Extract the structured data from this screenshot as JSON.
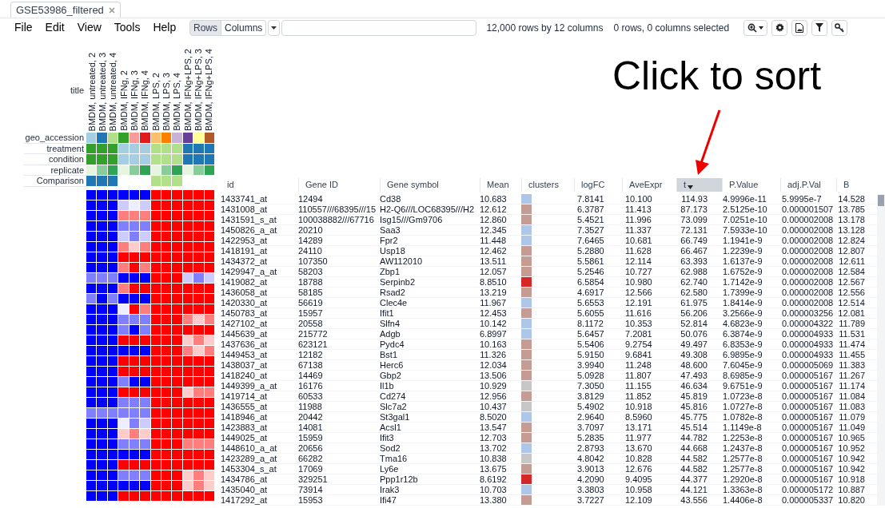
{
  "tab": {
    "title": "GSE53986_filtered"
  },
  "menu": [
    "File",
    "Edit",
    "View",
    "Tools",
    "Help"
  ],
  "toolbar": {
    "modes": [
      {
        "label": "Rows",
        "selected": true
      },
      {
        "label": "Columns",
        "selected": false
      }
    ],
    "summary": "12,000 rows by 12 columns",
    "selection": "0 rows, 0 columns selected"
  },
  "samples": {
    "label": "title",
    "titles": [
      "BMDM, untreated, 2",
      "BMDM, untreated, 3",
      "BMDM, untreated, 4",
      "BMDM, IFNg, 2",
      "BMDM, IFNg, 3",
      "BMDM, IFNg, 4",
      "BMDM, LPS, 2",
      "BMDM, LPS, 3",
      "BMDM, LPS, 4",
      "BMDM, IFNg+LPS, 2",
      "BMDM, IFNg+LPS, 3",
      "BMDM, IFNg+LPS, 4"
    ]
  },
  "annotations": [
    {
      "label": "geo_accession",
      "cells": [
        {
          "color": "#a6cee3"
        },
        {
          "color": "#1f78b4"
        },
        {
          "color": "#b2df8a"
        },
        {
          "color": "#33a02c"
        },
        {
          "color": "#fb9a99"
        },
        {
          "color": "#e31a1c"
        },
        {
          "color": "#fdbf6f"
        },
        {
          "color": "#ff7f00"
        },
        {
          "color": "#cab2d6"
        },
        {
          "color": "#6a3d9a"
        },
        {
          "color": "#ffff99"
        },
        {
          "color": "#b15928"
        }
      ]
    },
    {
      "label": "treatment",
      "cells": [
        {
          "color": "#33a02c"
        },
        {
          "color": "#33a02c"
        },
        {
          "color": "#33a02c"
        },
        {
          "color": "#a6cee3"
        },
        {
          "color": "#a6cee3"
        },
        {
          "color": "#a6cee3"
        },
        {
          "color": "#b2df8a"
        },
        {
          "color": "#b2df8a"
        },
        {
          "color": "#b2df8a"
        },
        {
          "color": "#1f78b4"
        },
        {
          "color": "#1f78b4"
        },
        {
          "color": "#1f78b4"
        }
      ]
    },
    {
      "label": "condition",
      "cells": [
        {
          "color": "#33a02c"
        },
        {
          "color": "#33a02c"
        },
        {
          "color": "#33a02c"
        },
        {
          "color": "#a6cee3"
        },
        {
          "color": "#a6cee3"
        },
        {
          "color": "#a6cee3"
        },
        {
          "color": "#b2df8a"
        },
        {
          "color": "#b2df8a"
        },
        {
          "color": "#b2df8a"
        },
        {
          "color": "#1f78b4"
        },
        {
          "color": "#1f78b4"
        },
        {
          "color": "#1f78b4"
        }
      ]
    },
    {
      "label": "replicate",
      "cells": [
        {
          "color": "#e5f5e0"
        },
        {
          "color": "#88cc99"
        },
        {
          "color": "#31a354"
        },
        {
          "color": "#e5f5e0"
        },
        {
          "color": "#88cc99"
        },
        {
          "color": "#31a354"
        },
        {
          "color": "#e5f5e0"
        },
        {
          "color": "#88cc99"
        },
        {
          "color": "#31a354"
        },
        {
          "color": "#e5f5e0"
        },
        {
          "color": "#88cc99"
        },
        {
          "color": "#31a354"
        }
      ]
    },
    {
      "label": "Comparison",
      "cells": [
        {
          "color": "#1f78b4"
        },
        {
          "color": "#1f78b4"
        },
        {
          "color": "#1f78b4"
        },
        {},
        {},
        {},
        {
          "color": "#b2df8a"
        },
        {
          "color": "#b2df8a"
        },
        {
          "color": "#b2df8a"
        },
        {},
        {},
        {}
      ]
    }
  ],
  "callout": {
    "text": "Click to sort"
  },
  "columns": [
    {
      "label": "id",
      "kind": "text",
      "sorted": false
    },
    {
      "label": "Gene ID",
      "kind": "text",
      "sorted": false
    },
    {
      "label": "Gene symbol",
      "kind": "text",
      "sorted": false
    },
    {
      "label": "Mean",
      "kind": "number",
      "sorted": false
    },
    {
      "label": "clusters",
      "kind": "color",
      "sorted": false
    },
    {
      "label": "logFC",
      "kind": "number",
      "sorted": false
    },
    {
      "label": "AveExpr",
      "kind": "number",
      "sorted": false
    },
    {
      "label": "t",
      "kind": "number",
      "sorted": true
    },
    {
      "label": "P.Value",
      "kind": "number",
      "sorted": false
    },
    {
      "label": "adj.P.Val",
      "kind": "number",
      "sorted": false
    },
    {
      "label": "B",
      "kind": "number",
      "sorted": false
    }
  ],
  "rows": [
    {
      "values": [
        "1433741_at",
        "12494",
        "Cd38",
        "10.683",
        "7.8141",
        "10.100",
        "114.93",
        "4.9996e-11",
        "5.9995e-7",
        "14.528"
      ],
      "color": "#aec7e8",
      "heat": [
        {
          "color": "#0000ff"
        },
        {
          "color": "#0000ff"
        },
        {
          "color": "#0000ff"
        },
        {
          "color": "#0000ff"
        },
        {
          "color": "#0000ff"
        },
        {
          "color": "#0000ff"
        },
        {
          "color": "#ff0000"
        },
        {
          "color": "#ff0000"
        },
        {
          "color": "#ff0000"
        },
        {
          "color": "#ff0000"
        },
        {
          "color": "#ff0000"
        },
        {
          "color": "#ff0000"
        }
      ]
    },
    {
      "values": [
        "1431008_at",
        "110557///68395///15",
        "H2-Q6///LOC68395///H2",
        "12.612",
        "6.3787",
        "11.413",
        "87.173",
        "2.5125e-10",
        "0.000001507",
        "13.785"
      ],
      "color": "#c49c94",
      "heat": [
        {
          "color": "#0000ff"
        },
        {
          "color": "#0000ff"
        },
        {
          "color": "#0000ff"
        },
        {
          "color": "#ccccff"
        },
        {
          "color": "#eeeeff"
        },
        {
          "color": "#ccccff"
        },
        {
          "color": "#ff0000"
        },
        {
          "color": "#ff0000"
        },
        {
          "color": "#ff0000"
        },
        {
          "color": "#ff0000"
        },
        {
          "color": "#ff0000"
        },
        {
          "color": "#ff0000"
        }
      ]
    },
    {
      "values": [
        "1431591_s_at",
        "100038882///67716",
        "Isg15///Gm9706",
        "12.860",
        "5.4521",
        "11.996",
        "73.099",
        "7.0251e-10",
        "0.000002008",
        "13.178"
      ],
      "color": "#c49c94",
      "heat": [
        {
          "color": "#0000ff"
        },
        {
          "color": "#0000ff"
        },
        {
          "color": "#0000ff"
        },
        {
          "color": "#ff7f7f"
        },
        {
          "color": "#ff7f7f"
        },
        {
          "color": "#ff7f7f"
        },
        {
          "color": "#ff0000"
        },
        {
          "color": "#ff0000"
        },
        {
          "color": "#ff0000"
        },
        {
          "color": "#ff0000"
        },
        {
          "color": "#ff0000"
        },
        {
          "color": "#ff0000"
        }
      ]
    },
    {
      "values": [
        "1450826_a_at",
        "20210",
        "Saa3",
        "12.345",
        "7.3527",
        "11.337",
        "72.131",
        "7.5933e-10",
        "0.000002008",
        "13.128"
      ],
      "color": "#aec7e8",
      "heat": [
        {
          "color": "#0000ff"
        },
        {
          "color": "#0000ff"
        },
        {
          "color": "#0000ff"
        },
        {
          "color": "#7f7fff"
        },
        {
          "color": "#7f7fff"
        },
        {
          "color": "#7f7fff"
        },
        {
          "color": "#ff0000"
        },
        {
          "color": "#ff0000"
        },
        {
          "color": "#ff0000"
        },
        {
          "color": "#ff0000"
        },
        {
          "color": "#ff0000"
        },
        {
          "color": "#ff0000"
        }
      ]
    },
    {
      "values": [
        "1422953_at",
        "14289",
        "Fpr2",
        "11.448",
        "7.6465",
        "10.681",
        "66.749",
        "1.1941e-9",
        "0.000002008",
        "12.824"
      ],
      "color": "#aec7e8",
      "heat": [
        {
          "color": "#0000ff"
        },
        {
          "color": "#0000ff"
        },
        {
          "color": "#0000ff"
        },
        {
          "color": "#ccccff"
        },
        {
          "color": "#7f7fff"
        },
        {
          "color": "#ccccff"
        },
        {
          "color": "#ff0000"
        },
        {
          "color": "#ff0000"
        },
        {
          "color": "#ff0000"
        },
        {
          "color": "#ff0000"
        },
        {
          "color": "#ff0000"
        },
        {
          "color": "#ff0000"
        }
      ]
    },
    {
      "values": [
        "1418191_at",
        "24110",
        "Usp18",
        "12.462",
        "5.2880",
        "11.628",
        "66.467",
        "1.2239e-9",
        "0.000002008",
        "12.807"
      ],
      "color": "#c49c94",
      "heat": [
        {
          "color": "#0000ff"
        },
        {
          "color": "#0000ff"
        },
        {
          "color": "#0000ff"
        },
        {
          "color": "#ff7f7f"
        },
        {
          "color": "#ffcccc"
        },
        {
          "color": "#ff7f7f"
        },
        {
          "color": "#ff0000"
        },
        {
          "color": "#ff0000"
        },
        {
          "color": "#ff0000"
        },
        {
          "color": "#ff0000"
        },
        {
          "color": "#ff0000"
        },
        {
          "color": "#ff0000"
        }
      ]
    },
    {
      "values": [
        "1434372_at",
        "107350",
        "AW112010",
        "13.511",
        "5.5861",
        "12.114",
        "63.393",
        "1.6137e-9",
        "0.000002008",
        "12.611"
      ],
      "color": "#c49c94",
      "heat": [
        {
          "color": "#0000ff"
        },
        {
          "color": "#0000ff"
        },
        {
          "color": "#0000ff"
        },
        {
          "color": "#ff0000"
        },
        {
          "color": "#ff0000"
        },
        {
          "color": "#ff0000"
        },
        {
          "color": "#ff0000"
        },
        {
          "color": "#ff0000"
        },
        {
          "color": "#ff0000"
        },
        {
          "color": "#ff0000"
        },
        {
          "color": "#ff0000"
        },
        {
          "color": "#ff0000"
        }
      ]
    },
    {
      "values": [
        "1429947_a_at",
        "58203",
        "Zbp1",
        "12.057",
        "5.2546",
        "10.727",
        "62.988",
        "1.6752e-9",
        "0.000002008",
        "12.584"
      ],
      "color": "#c49c94",
      "heat": [
        {
          "color": "#0000ff"
        },
        {
          "color": "#0000ff"
        },
        {
          "color": "#0000ff"
        },
        {
          "color": "#ff7f7f"
        },
        {
          "color": "#ff0000"
        },
        {
          "color": "#ff7f7f"
        },
        {
          "color": "#ff0000"
        },
        {
          "color": "#ff0000"
        },
        {
          "color": "#ff0000"
        },
        {
          "color": "#ff0000"
        },
        {
          "color": "#ff0000"
        },
        {
          "color": "#ff0000"
        }
      ]
    },
    {
      "values": [
        "1419082_at",
        "18788",
        "Serpinb2",
        "8.8510",
        "6.5854",
        "10.980",
        "62.740",
        "1.7142e-9",
        "0.000002008",
        "12.567"
      ],
      "color": "#d62728",
      "heat": [
        {
          "color": "#7f7fff"
        },
        {
          "color": "#7f7fff"
        },
        {
          "color": "#7f7fff"
        },
        {
          "color": "#0000ff"
        },
        {
          "color": "#0000ff"
        },
        {
          "color": "#0000ff"
        },
        {
          "color": "#ff0000"
        },
        {
          "color": "#ff0000"
        },
        {
          "color": "#ff0000"
        },
        {
          "color": "#ccccff"
        },
        {
          "color": "#7f7fff"
        },
        {
          "color": "#ccccff"
        }
      ]
    },
    {
      "values": [
        "1436058_at",
        "58185",
        "Rsad2",
        "13.219",
        "4.6917",
        "12.566",
        "62.580",
        "1.7399e-9",
        "0.000002008",
        "12.556"
      ],
      "color": "#c49c94",
      "heat": [
        {
          "color": "#0000ff"
        },
        {
          "color": "#0000ff"
        },
        {
          "color": "#0000ff"
        },
        {
          "color": "#ff7f7f"
        },
        {
          "color": "#ff0000"
        },
        {
          "color": "#ff0000"
        },
        {
          "color": "#ff0000"
        },
        {
          "color": "#ff0000"
        },
        {
          "color": "#ff0000"
        },
        {
          "color": "#ff0000"
        },
        {
          "color": "#ff0000"
        },
        {
          "color": "#ff0000"
        }
      ]
    },
    {
      "values": [
        "1420330_at",
        "56619",
        "Clec4e",
        "11.967",
        "5.6553",
        "12.191",
        "61.975",
        "1.8414e-9",
        "0.000002008",
        "12.514"
      ],
      "color": "#aec7e8",
      "heat": [
        {
          "color": "#7f7fff"
        },
        {
          "color": "#0000ff"
        },
        {
          "color": "#7f7fff"
        },
        {
          "color": "#0000ff"
        },
        {
          "color": "#0000ff"
        },
        {
          "color": "#0000ff"
        },
        {
          "color": "#ff0000"
        },
        {
          "color": "#ff0000"
        },
        {
          "color": "#ff0000"
        },
        {
          "color": "#ff0000"
        },
        {
          "color": "#ff0000"
        },
        {
          "color": "#ff0000"
        }
      ]
    },
    {
      "values": [
        "1450783_at",
        "15957",
        "Ifit1",
        "12.453",
        "5.6055",
        "11.616",
        "56.206",
        "3.2566e-9",
        "0.000003256",
        "12.081"
      ],
      "color": "#c49c94",
      "heat": [
        {
          "color": "#0000ff"
        },
        {
          "color": "#0000ff"
        },
        {
          "color": "#0000ff"
        },
        {
          "color": "#eeeeff"
        },
        {
          "color": "#ff0000"
        },
        {
          "color": "#ff7f7f"
        },
        {
          "color": "#ff0000"
        },
        {
          "color": "#ff0000"
        },
        {
          "color": "#ff0000"
        },
        {
          "color": "#ff0000"
        },
        {
          "color": "#ff0000"
        },
        {
          "color": "#ff0000"
        }
      ]
    },
    {
      "values": [
        "1427102_at",
        "20558",
        "Slfn4",
        "10.142",
        "8.1172",
        "10.353",
        "52.814",
        "4.6823e-9",
        "0.000004322",
        "11.789"
      ],
      "color": "#aec7e8",
      "heat": [
        {
          "color": "#0000ff"
        },
        {
          "color": "#0000ff"
        },
        {
          "color": "#0000ff"
        },
        {
          "color": "#7f7fff"
        },
        {
          "color": "#7f7fff"
        },
        {
          "color": "#7f7fff"
        },
        {
          "color": "#ff0000"
        },
        {
          "color": "#ff0000"
        },
        {
          "color": "#ff0000"
        },
        {
          "color": "#ff7f7f"
        },
        {
          "color": "#ffcccc"
        },
        {
          "color": "#ff7f7f"
        }
      ]
    },
    {
      "values": [
        "1445639_at",
        "215772",
        "Adgb",
        "6.8997",
        "5.6457",
        "7.2081",
        "50.076",
        "6.3874e-9",
        "0.000004933",
        "11.531"
      ],
      "color": "#aec7e8",
      "heat": [
        {
          "color": "#0000ff"
        },
        {
          "color": "#0000ff"
        },
        {
          "color": "#0000ff"
        },
        {
          "color": "#7f7fff"
        },
        {
          "color": "#0000ff"
        },
        {
          "color": "#7f7fff"
        },
        {
          "color": "#ff0000"
        },
        {
          "color": "#ff0000"
        },
        {
          "color": "#ff0000"
        },
        {
          "color": "#ff0000"
        },
        {
          "color": "#ff0000"
        },
        {
          "color": "#ff0000"
        }
      ]
    },
    {
      "values": [
        "1437636_at",
        "623121",
        "Pydc4",
        "10.163",
        "5.5406",
        "9.2754",
        "49.497",
        "6.8353e-9",
        "0.000004933",
        "11.474"
      ],
      "color": "#c49c94",
      "heat": [
        {
          "color": "#0000ff"
        },
        {
          "color": "#0000ff"
        },
        {
          "color": "#0000ff"
        },
        {
          "color": "#ff0000"
        },
        {
          "color": "#ff0000"
        },
        {
          "color": "#ff0000"
        },
        {
          "color": "#ff0000"
        },
        {
          "color": "#ff0000"
        },
        {
          "color": "#ff0000"
        },
        {
          "color": "#ffcccc"
        },
        {
          "color": "#ff7f7f"
        },
        {
          "color": "#ffcccc"
        }
      ]
    },
    {
      "values": [
        "1449453_at",
        "12182",
        "Bst1",
        "11.326",
        "5.9150",
        "9.6841",
        "49.308",
        "6.9895e-9",
        "0.000004933",
        "11.455"
      ],
      "color": "#c49c94",
      "heat": [
        {
          "color": "#0000ff"
        },
        {
          "color": "#0000ff"
        },
        {
          "color": "#0000ff"
        },
        {
          "color": "#0000ff"
        },
        {
          "color": "#0000ff"
        },
        {
          "color": "#0000ff"
        },
        {
          "color": "#ff0000"
        },
        {
          "color": "#ff0000"
        },
        {
          "color": "#ff0000"
        },
        {
          "color": "#ff7f7f"
        },
        {
          "color": "#ffcccc"
        },
        {
          "color": "#ff7f7f"
        }
      ]
    },
    {
      "values": [
        "1438037_at",
        "67138",
        "Herc6",
        "12.034",
        "3.9940",
        "11.248",
        "48.600",
        "7.6045e-9",
        "0.000005069",
        "11.383"
      ],
      "color": "#c49c94",
      "heat": [
        {
          "color": "#0000ff"
        },
        {
          "color": "#0000ff"
        },
        {
          "color": "#0000ff"
        },
        {
          "color": "#ff0000"
        },
        {
          "color": "#ff0000"
        },
        {
          "color": "#ff0000"
        },
        {
          "color": "#ff0000"
        },
        {
          "color": "#ff0000"
        },
        {
          "color": "#ff0000"
        },
        {
          "color": "#ff0000"
        },
        {
          "color": "#ff0000"
        },
        {
          "color": "#ff0000"
        }
      ]
    },
    {
      "values": [
        "1418240_at",
        "14469",
        "Gbp2",
        "13.506",
        "5.0928",
        "11.807",
        "47.493",
        "8.6985e-9",
        "0.000005167",
        "11.267"
      ],
      "color": "#c49c94",
      "heat": [
        {
          "color": "#0000ff"
        },
        {
          "color": "#0000ff"
        },
        {
          "color": "#0000ff"
        },
        {
          "color": "#ff0000"
        },
        {
          "color": "#ff0000"
        },
        {
          "color": "#ff0000"
        },
        {
          "color": "#ff0000"
        },
        {
          "color": "#ff0000"
        },
        {
          "color": "#ff0000"
        },
        {
          "color": "#ff0000"
        },
        {
          "color": "#ff0000"
        },
        {
          "color": "#ff0000"
        }
      ]
    },
    {
      "values": [
        "1449399_a_at",
        "16176",
        "Il1b",
        "10.929",
        "7.3050",
        "11.155",
        "46.634",
        "9.6751e-9",
        "0.000005167",
        "11.174"
      ],
      "color": "#c7c7c7",
      "heat": [
        {
          "color": "#0000ff"
        },
        {
          "color": "#0000ff"
        },
        {
          "color": "#0000ff"
        },
        {
          "color": "#7f7fff"
        },
        {
          "color": "#0000ff"
        },
        {
          "color": "#0000ff"
        },
        {
          "color": "#ff0000"
        },
        {
          "color": "#ff0000"
        },
        {
          "color": "#ff0000"
        },
        {
          "color": "#ff0000"
        },
        {
          "color": "#ff0000"
        },
        {
          "color": "#ff0000"
        }
      ]
    },
    {
      "values": [
        "1419714_at",
        "60533",
        "Cd274",
        "12.956",
        "3.8129",
        "11.852",
        "45.819",
        "1.0723e-8",
        "0.000005167",
        "11.084"
      ],
      "color": "#c49c94",
      "heat": [
        {
          "color": "#0000ff"
        },
        {
          "color": "#0000ff"
        },
        {
          "color": "#0000ff"
        },
        {
          "color": "#ff0000"
        },
        {
          "color": "#ff0000"
        },
        {
          "color": "#ff0000"
        },
        {
          "color": "#ff0000"
        },
        {
          "color": "#ff0000"
        },
        {
          "color": "#ff0000"
        },
        {
          "color": "#ffcccc"
        },
        {
          "color": "#ff7f7f"
        },
        {
          "color": "#ff7f7f"
        }
      ]
    },
    {
      "values": [
        "1436555_at",
        "11988",
        "Slc7a2",
        "10.437",
        "5.4902",
        "10.918",
        "45.816",
        "1.0727e-8",
        "0.000005167",
        "11.083"
      ],
      "color": "#c7c7c7",
      "heat": [
        {
          "color": "#0000ff"
        },
        {
          "color": "#0000ff"
        },
        {
          "color": "#0000ff"
        },
        {
          "color": "#7f7fff"
        },
        {
          "color": "#7f7fff"
        },
        {
          "color": "#7f7fff"
        },
        {
          "color": "#ff0000"
        },
        {
          "color": "#ff0000"
        },
        {
          "color": "#ff0000"
        },
        {
          "color": "#ff0000"
        },
        {
          "color": "#ff0000"
        },
        {
          "color": "#ff0000"
        }
      ]
    },
    {
      "values": [
        "1418946_at",
        "20442",
        "St3gal1",
        "8.5020",
        "2.9640",
        "8.5960",
        "45.775",
        "1.0782e-8",
        "0.000005167",
        "11.079"
      ],
      "color": "#aec7e8",
      "heat": [
        {
          "color": "#7f7fff"
        },
        {
          "color": "#7f7fff"
        },
        {
          "color": "#7f7fff"
        },
        {
          "color": "#7f7fff"
        },
        {
          "color": "#7f7fff"
        },
        {
          "color": "#7f7fff"
        },
        {
          "color": "#ff0000"
        },
        {
          "color": "#ff0000"
        },
        {
          "color": "#ff0000"
        },
        {
          "color": "#ff0000"
        },
        {
          "color": "#ff0000"
        },
        {
          "color": "#ff0000"
        }
      ]
    },
    {
      "values": [
        "1423883_at",
        "14081",
        "Acsl1",
        "13.547",
        "3.7097",
        "13.171",
        "45.514",
        "1.1149e-8",
        "0.000005167",
        "11.049"
      ],
      "color": "#c49c94",
      "heat": [
        {
          "color": "#0000ff"
        },
        {
          "color": "#0000ff"
        },
        {
          "color": "#0000ff"
        },
        {
          "color": "#eeeeff"
        },
        {
          "color": "#7f7fff"
        },
        {
          "color": "#ccccff"
        },
        {
          "color": "#ff0000"
        },
        {
          "color": "#ff0000"
        },
        {
          "color": "#ff0000"
        },
        {
          "color": "#ff0000"
        },
        {
          "color": "#ff0000"
        },
        {
          "color": "#ff0000"
        }
      ]
    },
    {
      "values": [
        "1449025_at",
        "15959",
        "Ifit3",
        "12.703",
        "5.2835",
        "11.977",
        "44.782",
        "1.2253e-8",
        "0.000005167",
        "10.965"
      ],
      "color": "#c49c94",
      "heat": [
        {
          "color": "#0000ff"
        },
        {
          "color": "#0000ff"
        },
        {
          "color": "#0000ff"
        },
        {
          "color": "#ffcccc"
        },
        {
          "color": "#ff7f7f"
        },
        {
          "color": "#ffcccc"
        },
        {
          "color": "#ff0000"
        },
        {
          "color": "#ff0000"
        },
        {
          "color": "#ff0000"
        },
        {
          "color": "#ff0000"
        },
        {
          "color": "#ff0000"
        },
        {
          "color": "#ff0000"
        }
      ]
    },
    {
      "values": [
        "1448610_a_at",
        "20656",
        "Sod2",
        "13.702",
        "2.8793",
        "13.670",
        "44.668",
        "1.2437e-8",
        "0.000005167",
        "10.952"
      ],
      "color": "#aec7e8",
      "heat": [
        {
          "color": "#0000ff"
        },
        {
          "color": "#0000ff"
        },
        {
          "color": "#0000ff"
        },
        {
          "color": "#7f7fff"
        },
        {
          "color": "#7f7fff"
        },
        {
          "color": "#7f7fff"
        },
        {
          "color": "#ff0000"
        },
        {
          "color": "#ff0000"
        },
        {
          "color": "#ff0000"
        },
        {
          "color": "#ff7f7f"
        },
        {
          "color": "#ff7f7f"
        },
        {
          "color": "#ff7f7f"
        }
      ]
    },
    {
      "values": [
        "1423289_a_at",
        "66282",
        "Tma16",
        "10.838",
        "4.8042",
        "10.828",
        "44.582",
        "1.2577e-8",
        "0.000005167",
        "10.942"
      ],
      "color": "#c7c7c7",
      "heat": [
        {
          "color": "#0000ff"
        },
        {
          "color": "#0000ff"
        },
        {
          "color": "#0000ff"
        },
        {
          "color": "#0000ff"
        },
        {
          "color": "#0000ff"
        },
        {
          "color": "#0000ff"
        },
        {
          "color": "#ff0000"
        },
        {
          "color": "#ff0000"
        },
        {
          "color": "#ff0000"
        },
        {
          "color": "#ff0000"
        },
        {
          "color": "#ff0000"
        },
        {
          "color": "#ff0000"
        }
      ]
    },
    {
      "values": [
        "1453304_s_at",
        "17069",
        "Ly6e",
        "13.675",
        "3.9013",
        "12.676",
        "44.582",
        "1.2577e-8",
        "0.000005167",
        "10.942"
      ],
      "color": "#c49c94",
      "heat": [
        {
          "color": "#0000ff"
        },
        {
          "color": "#0000ff"
        },
        {
          "color": "#0000ff"
        },
        {
          "color": "#ff0000"
        },
        {
          "color": "#ff0000"
        },
        {
          "color": "#ff0000"
        },
        {
          "color": "#ff0000"
        },
        {
          "color": "#ff0000"
        },
        {
          "color": "#ff0000"
        },
        {
          "color": "#ff0000"
        },
        {
          "color": "#ff0000"
        },
        {
          "color": "#ff0000"
        }
      ]
    },
    {
      "values": [
        "1434786_at",
        "329251",
        "Ppp1r12b",
        "8.6192",
        "4.2090",
        "9.4095",
        "44.377",
        "1.2920e-8",
        "0.000005167",
        "10.918"
      ],
      "color": "#d62728",
      "heat": [
        {
          "color": "#0000ff"
        },
        {
          "color": "#0000ff"
        },
        {
          "color": "#0000ff"
        },
        {
          "color": "#7f7fff"
        },
        {
          "color": "#7f7fff"
        },
        {
          "color": "#7f7fff"
        },
        {
          "color": "#ff0000"
        },
        {
          "color": "#ff0000"
        },
        {
          "color": "#ff0000"
        },
        {
          "color": "#ffcccc"
        },
        {
          "color": "#ff7f7f"
        },
        {
          "color": "#ffcccc"
        }
      ]
    },
    {
      "values": [
        "1435040_at",
        "73914",
        "Irak3",
        "10.703",
        "3.3803",
        "10.958",
        "44.121",
        "1.3363e-8",
        "0.000005172",
        "10.887"
      ],
      "color": "#aec7e8",
      "heat": [
        {
          "color": "#0000ff"
        },
        {
          "color": "#0000ff"
        },
        {
          "color": "#0000ff"
        },
        {
          "color": "#0000ff"
        },
        {
          "color": "#0000ff"
        },
        {
          "color": "#0000ff"
        },
        {
          "color": "#ff0000"
        },
        {
          "color": "#ff0000"
        },
        {
          "color": "#ff0000"
        },
        {
          "color": "#ffcccc"
        },
        {
          "color": "#ff7f7f"
        },
        {
          "color": "#ffcccc"
        }
      ]
    },
    {
      "values": [
        "1417292_at",
        "15953",
        "Ifi47",
        "13.380",
        "3.7227",
        "12.109",
        "43.556",
        "1.4406e-8",
        "0.000005337",
        "10.820"
      ],
      "color": "#c49c94",
      "heat": [
        {
          "color": "#0000ff"
        },
        {
          "color": "#0000ff"
        },
        {
          "color": "#0000ff"
        },
        {
          "color": "#ff0000"
        },
        {
          "color": "#ff0000"
        },
        {
          "color": "#ff0000"
        },
        {
          "color": "#ff0000"
        },
        {
          "color": "#ff0000"
        },
        {
          "color": "#ff0000"
        },
        {
          "color": "#ff0000"
        },
        {
          "color": "#ff0000"
        },
        {
          "color": "#ff0000"
        }
      ]
    }
  ]
}
